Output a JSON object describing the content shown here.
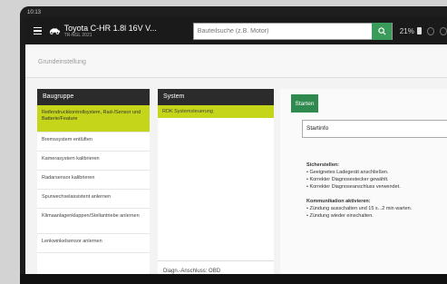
{
  "statusbar": {
    "time": "10:13"
  },
  "header": {
    "vehicle_name": "Toyota C-HR 1.8l 16V V...",
    "vehicle_sub": "TR-NGL 2021",
    "search_placeholder": "Bauteilsuche (z.B. Motor)",
    "battery": "21%"
  },
  "page_title": "Grundeinstellung",
  "baugruppe": {
    "header": "Baugruppe",
    "items": [
      "Reifendruckkontrollsystem, Rad-/Sensor und Batterie/Feature",
      "Bremssystem entlüften",
      "Kamerasystem kalibrieren",
      "Radarsensor kalibrieren",
      "Spurwechselassistent anlernen",
      "Klimaanlagenklappen/Stellantriebe anlernen",
      "Lenkwinkelsensor anlernen"
    ]
  },
  "system": {
    "header": "System",
    "item": "RDK Systemsteuerung",
    "diag": "Diagn.-Anschluss: OBD"
  },
  "right": {
    "start_label": "Starten",
    "startinfo": "Startinfo",
    "section1_title": "Sicherstellen:",
    "section1_items": [
      "• Geeignetes Ladegerät anschließen.",
      "• Korrekter Diagnosestecker gewählt.",
      "• Korrekter Diagnoseanschluss verwendet."
    ],
    "section2_title": "Kommunikation aktivieren:",
    "section2_items": [
      "• Zündung ausschalten und 15 s...2 min warten.",
      "• Zündung wieder einschalten."
    ]
  }
}
